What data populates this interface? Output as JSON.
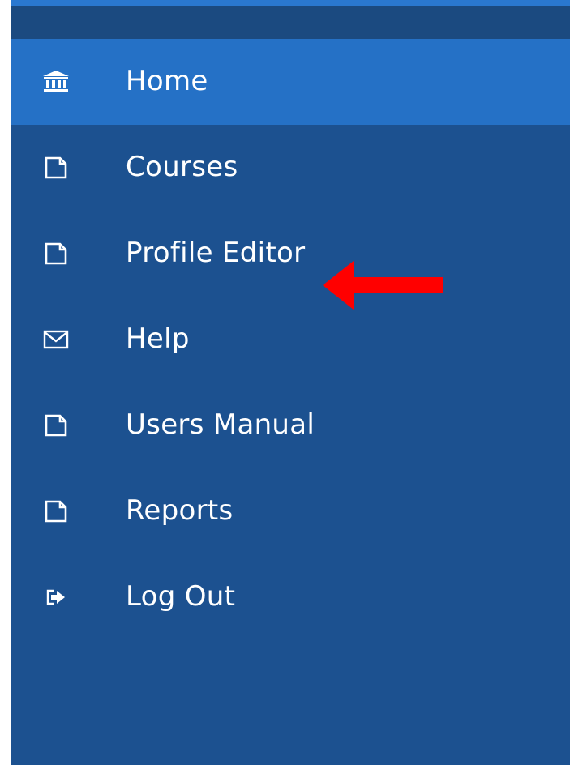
{
  "colors": {
    "accent_top": "#2a78d0",
    "header_strip": "#1b4a80",
    "sidebar_bg": "#1c5190",
    "active_item_bg": "#2571c6",
    "text": "#ffffff",
    "annotation_arrow": "#ff0000"
  },
  "sidebar": {
    "items": [
      {
        "label": "Home",
        "icon": "bank-icon",
        "active": true
      },
      {
        "label": "Courses",
        "icon": "page-icon",
        "active": false
      },
      {
        "label": "Profile Editor",
        "icon": "page-icon",
        "active": false
      },
      {
        "label": "Help",
        "icon": "envelope-icon",
        "active": false
      },
      {
        "label": "Users Manual",
        "icon": "page-icon",
        "active": false
      },
      {
        "label": "Reports",
        "icon": "page-icon",
        "active": false
      },
      {
        "label": "Log Out",
        "icon": "logout-icon",
        "active": false
      }
    ]
  },
  "annotation": {
    "type": "arrow",
    "direction": "left",
    "points_to": "Profile Editor"
  }
}
